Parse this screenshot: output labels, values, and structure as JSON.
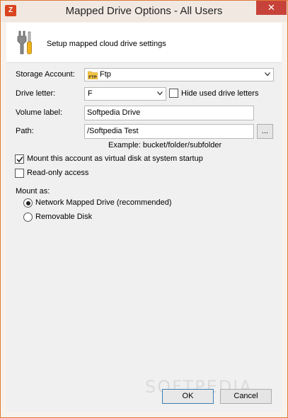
{
  "window": {
    "title": "Mapped Drive Options - All Users",
    "close_glyph": "✕"
  },
  "header": {
    "description": "Setup mapped cloud drive settings",
    "icon": "tools-icon"
  },
  "form": {
    "storage_account_label": "Storage Account:",
    "storage_account_value": "Ftp",
    "drive_letter_label": "Drive letter:",
    "drive_letter_value": "F",
    "hide_used_label": "Hide used drive letters",
    "hide_used_checked": false,
    "volume_label_label": "Volume label:",
    "volume_label_value": "Softpedia Drive",
    "path_label": "Path:",
    "path_value": "/Softpedia Test",
    "browse_label": "...",
    "path_example": "Example: bucket/folder/subfolder",
    "mount_at_startup_label": "Mount this account as virtual disk at system startup",
    "mount_at_startup_checked": true,
    "read_only_label": "Read-only access",
    "read_only_checked": false,
    "mount_as_label": "Mount as:",
    "mount_options": [
      {
        "label": "Network Mapped Drive (recommended)",
        "selected": true
      },
      {
        "label": "Removable Disk",
        "selected": false
      }
    ]
  },
  "buttons": {
    "ok": "OK",
    "cancel": "Cancel"
  },
  "watermark": "SOFTPEDIA",
  "colors": {
    "window_border": "#e07a33",
    "close_button": "#c7433a",
    "ok_border": "#3c7fb1"
  }
}
